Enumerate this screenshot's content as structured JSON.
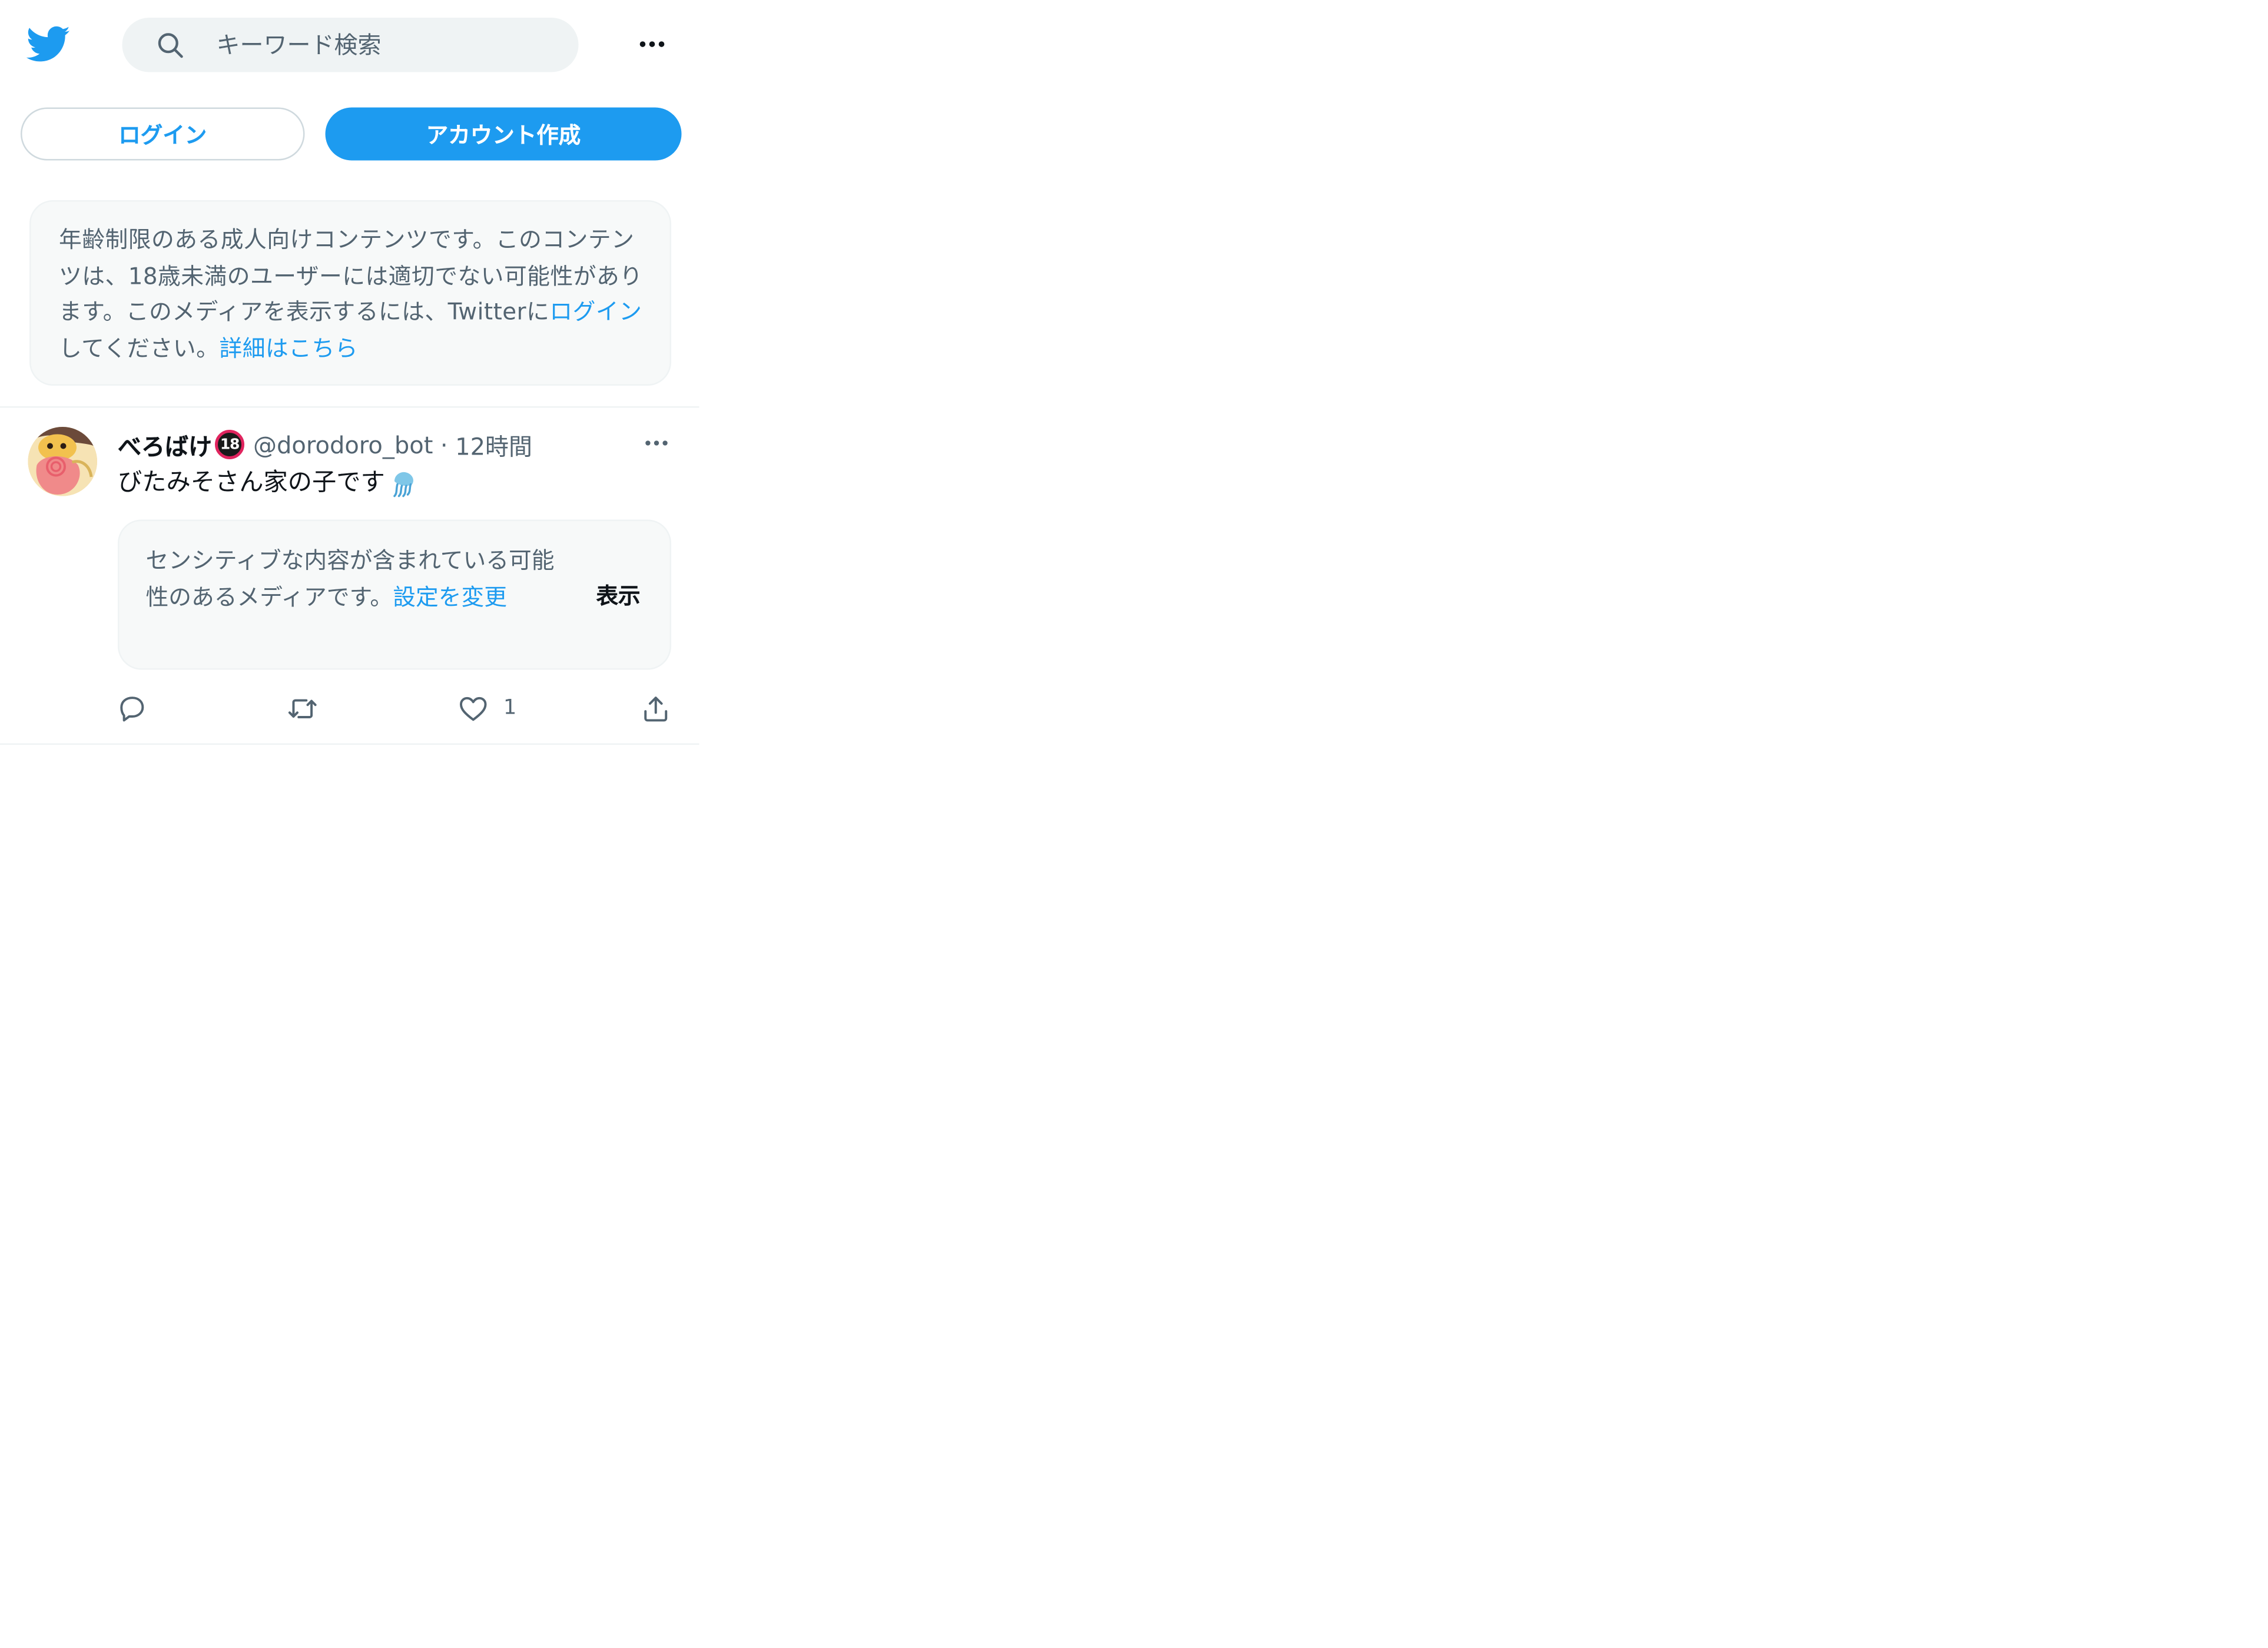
{
  "header": {
    "logo_icon": "twitter-bird-icon",
    "search_icon": "search-icon",
    "search_placeholder": "キーワード検索",
    "search_value": "",
    "more_icon": "more-horizontal-icon"
  },
  "auth": {
    "login_label": "ログイン",
    "signup_label": "アカウント作成"
  },
  "notice": {
    "text_before": "年齢制限のある成人向けコンテンツです。このコンテンツは、18歳未満のユーザーには適切でない可能性があります。このメディアを表示するには、Twitterに",
    "login_link": "ログイン",
    "text_middle": "してください。",
    "details_link": "詳細はこちら"
  },
  "tweet": {
    "display_name": "べろばけ",
    "age_badge": "18",
    "handle": "@dorodoro_bot",
    "separator": "·",
    "time": "12時間",
    "text": "びたみそさん家の子です",
    "emoji_icon": "jellyfish-emoji-icon",
    "sensitive": {
      "text": "センシティブな内容が含まれている可能性のあるメディアです。",
      "settings_link": "設定を変更",
      "show_label": "表示"
    },
    "actions": {
      "reply_icon": "reply-icon",
      "retweet_icon": "retweet-icon",
      "like_icon": "heart-icon",
      "like_count": "1",
      "share_icon": "share-icon"
    }
  },
  "colors": {
    "accent": "#1d9bf0",
    "text_primary": "#0f1419",
    "text_secondary": "#536471",
    "panel_bg": "#f7f9f9",
    "search_bg": "#eff3f4",
    "divider": "#eff3f4",
    "badge_ring": "#e0245e"
  }
}
